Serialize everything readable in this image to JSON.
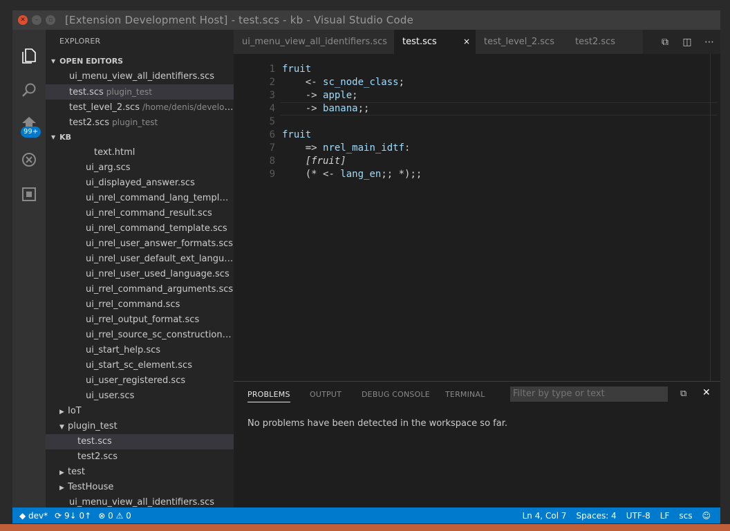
{
  "window": {
    "title": "[Extension Development Host] - test.scs - kb - Visual Studio Code"
  },
  "activity": {
    "badge": "99+"
  },
  "sidebar": {
    "title": "EXPLORER",
    "open_editors": {
      "label": "OPEN EDITORS",
      "items": [
        {
          "name": "ui_menu_view_all_identifiers.scs",
          "desc": ""
        },
        {
          "name": "test.scs",
          "desc": "plugin_test"
        },
        {
          "name": "test_level_2.scs",
          "desc": "/home/denis/develop/..."
        },
        {
          "name": "test2.scs",
          "desc": "plugin_test"
        }
      ]
    },
    "kb": {
      "label": "KB",
      "items": [
        {
          "name": "text.html"
        },
        {
          "name": "ui_arg.scs"
        },
        {
          "name": "ui_displayed_answer.scs"
        },
        {
          "name": "ui_nrel_command_lang_template...."
        },
        {
          "name": "ui_nrel_command_result.scs"
        },
        {
          "name": "ui_nrel_command_template.scs"
        },
        {
          "name": "ui_nrel_user_answer_formats.scs"
        },
        {
          "name": "ui_nrel_user_default_ext_languag..."
        },
        {
          "name": "ui_nrel_user_used_language.scs"
        },
        {
          "name": "ui_rrel_command_arguments.scs"
        },
        {
          "name": "ui_rrel_command.scs"
        },
        {
          "name": "ui_rrel_output_format.scs"
        },
        {
          "name": "ui_rrel_source_sc_construction.scs"
        },
        {
          "name": "ui_start_help.scs"
        },
        {
          "name": "ui_start_sc_element.scs"
        },
        {
          "name": "ui_user_registered.scs"
        },
        {
          "name": "ui_user.scs"
        },
        {
          "name": "IoT"
        },
        {
          "name": "plugin_test"
        },
        {
          "name": "test.scs"
        },
        {
          "name": "test2.scs"
        },
        {
          "name": "test"
        },
        {
          "name": "TestHouse"
        },
        {
          "name": "ui_menu_view_all_identifiers.scs"
        }
      ]
    }
  },
  "tabs": [
    {
      "label": "ui_menu_view_all_identifiers.scs"
    },
    {
      "label": "test.scs",
      "close": "×"
    },
    {
      "label": "test_level_2.scs"
    },
    {
      "label": "test2.scs"
    }
  ],
  "editor": {
    "line_numbers": [
      "1",
      "2",
      "3",
      "4",
      "5",
      "6",
      "7",
      "8",
      "9"
    ],
    "lines": [
      {
        "a": "fruit",
        "b": "",
        "c": ""
      },
      {
        "a": "    <- ",
        "b": "sc_node_class",
        "c": ";"
      },
      {
        "a": "    -> ",
        "b": "apple",
        "c": ";"
      },
      {
        "a": "    -> ",
        "b": "banana",
        "c": ";;"
      },
      {
        "a": "",
        "b": "",
        "c": ""
      },
      {
        "a": "fruit",
        "b": "",
        "c": ""
      },
      {
        "a": "    => ",
        "b": "nrel_main_idtf",
        "c": ":"
      },
      {
        "a": "    ",
        "b": "",
        "c": "[fruit]"
      },
      {
        "a": "    (* <- ",
        "b": "lang_en",
        "c": ";; *);;"
      }
    ]
  },
  "panel": {
    "tabs": [
      "PROBLEMS",
      "OUTPUT",
      "DEBUG CONSOLE",
      "TERMINAL"
    ],
    "filter_placeholder": "Filter by type or text",
    "message": "No problems have been detected in the workspace so far."
  },
  "statusbar": {
    "branch": "dev*",
    "sync": "9↓ 0↑",
    "errors": "0",
    "warnings": "0",
    "position": "Ln 4, Col 7",
    "spaces": "Spaces: 4",
    "encoding": "UTF-8",
    "eol": "LF",
    "language": "scs"
  }
}
